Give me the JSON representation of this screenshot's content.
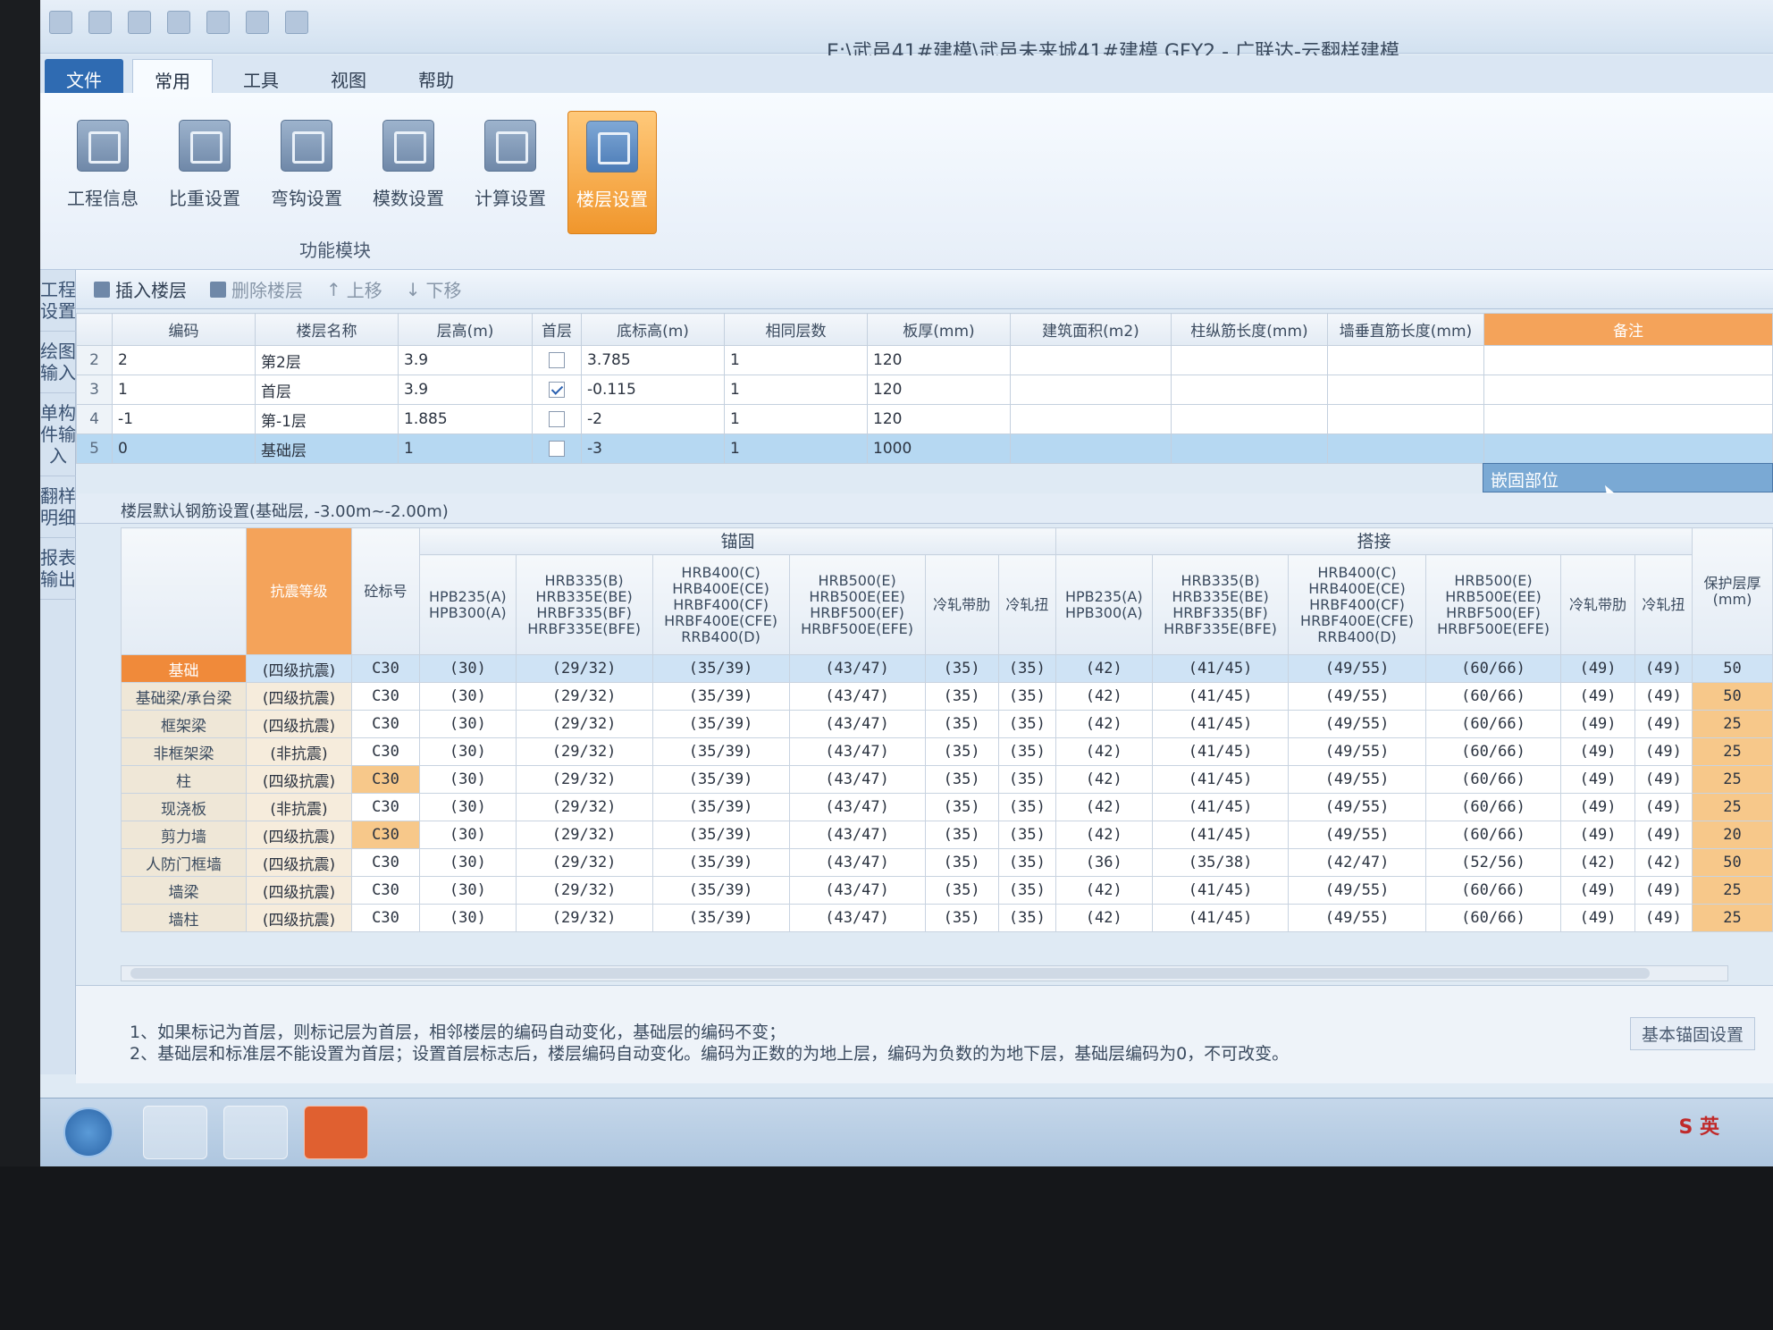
{
  "window": {
    "title": "E:\\武邑41#建模\\武邑未来城41#建模.GFY2 - 广联达-云翻样建模"
  },
  "menu_tabs": [
    "文件",
    "常用",
    "工具",
    "视图",
    "帮助"
  ],
  "ribbon": {
    "buttons": [
      "工程信息",
      "比重设置",
      "弯钩设置",
      "模数设置",
      "计算设置",
      "楼层设置"
    ],
    "group_label": "功能模块"
  },
  "sidebar": [
    "工程设置",
    "绘图输入",
    "单构件输入",
    "翻样明细",
    "报表输出"
  ],
  "toolbar": {
    "insert": "插入楼层",
    "delete": "删除楼层",
    "up": "上移",
    "down": "下移"
  },
  "floors": {
    "headers": [
      "",
      "编码",
      "楼层名称",
      "层高(m)",
      "首层",
      "底标高(m)",
      "相同层数",
      "板厚(mm)",
      "建筑面积(m2)",
      "柱纵筋长度(mm)",
      "墙垂直筋长度(mm)",
      "备注"
    ],
    "rows": [
      {
        "n": "2",
        "code": "2",
        "name": "第2层",
        "height": "3.9",
        "first": false,
        "bottom": "3.785",
        "same": "1",
        "slab": "120"
      },
      {
        "n": "3",
        "code": "1",
        "name": "首层",
        "height": "3.9",
        "first": true,
        "bottom": "-0.115",
        "same": "1",
        "slab": "120"
      },
      {
        "n": "4",
        "code": "-1",
        "name": "第-1层",
        "height": "1.885",
        "first": false,
        "bottom": "-2",
        "same": "1",
        "slab": "120"
      },
      {
        "n": "5",
        "code": "0",
        "name": "基础层",
        "height": "1",
        "first": false,
        "bottom": "-3",
        "same": "1",
        "slab": "1000"
      }
    ],
    "note_value": "嵌固部位"
  },
  "rebar_section": {
    "title": "楼层默认钢筋设置(基础层, -3.00m~-2.00m)",
    "group_anchor": "锚固",
    "group_lap": "搭接",
    "headers": [
      "抗震等级",
      "砼标号",
      "HPB235(A)\nHPB300(A)",
      "HRB335(B)\nHRB335E(BE)\nHRBF335(BF)\nHRBF335E(BFE)",
      "HRB400(C)\nHRB400E(CE)\nHRBF400(CF)\nHRBF400E(CFE)\nRRB400(D)",
      "HRB500(E)\nHRB500E(EE)\nHRBF500(EF)\nHRBF500E(EFE)",
      "冷轧带肋",
      "冷轧扭",
      "HPB235(A)\nHPB300(A)",
      "HRB335(B)\nHRB335E(BE)\nHRBF335(BF)\nHRBF335E(BFE)",
      "HRB400(C)\nHRB400E(CE)\nHRBF400(CF)\nHRBF400E(CFE)\nRRB400(D)",
      "HRB500(E)\nHRB500E(EE)\nHRBF500(EF)\nHRBF500E(EFE)",
      "冷轧带肋",
      "冷轧扭",
      "保护层厚\n(mm)"
    ],
    "rows": [
      {
        "name": "基础",
        "seis": "(四级抗震)",
        "c": "C30",
        "a": [
          "(30)",
          "(29/32)",
          "(35/39)",
          "(43/47)",
          "(35)",
          "(35)"
        ],
        "l": [
          "(42)",
          "(41/45)",
          "(49/55)",
          "(60/66)",
          "(49)",
          "(49)"
        ],
        "cover": "50"
      },
      {
        "name": "基础梁/承台梁",
        "seis": "(四级抗震)",
        "c": "C30",
        "a": [
          "(30)",
          "(29/32)",
          "(35/39)",
          "(43/47)",
          "(35)",
          "(35)"
        ],
        "l": [
          "(42)",
          "(41/45)",
          "(49/55)",
          "(60/66)",
          "(49)",
          "(49)"
        ],
        "cover": "50"
      },
      {
        "name": "框架梁",
        "seis": "(四级抗震)",
        "c": "C30",
        "a": [
          "(30)",
          "(29/32)",
          "(35/39)",
          "(43/47)",
          "(35)",
          "(35)"
        ],
        "l": [
          "(42)",
          "(41/45)",
          "(49/55)",
          "(60/66)",
          "(49)",
          "(49)"
        ],
        "cover": "25"
      },
      {
        "name": "非框架梁",
        "seis": "(非抗震)",
        "c": "C30",
        "a": [
          "(30)",
          "(29/32)",
          "(35/39)",
          "(43/47)",
          "(35)",
          "(35)"
        ],
        "l": [
          "(42)",
          "(41/45)",
          "(49/55)",
          "(60/66)",
          "(49)",
          "(49)"
        ],
        "cover": "25"
      },
      {
        "name": "柱",
        "seis": "(四级抗震)",
        "c": "C30",
        "a": [
          "(30)",
          "(29/32)",
          "(35/39)",
          "(43/47)",
          "(35)",
          "(35)"
        ],
        "l": [
          "(42)",
          "(41/45)",
          "(49/55)",
          "(60/66)",
          "(49)",
          "(49)"
        ],
        "cover": "25"
      },
      {
        "name": "现浇板",
        "seis": "(非抗震)",
        "c": "C30",
        "a": [
          "(30)",
          "(29/32)",
          "(35/39)",
          "(43/47)",
          "(35)",
          "(35)"
        ],
        "l": [
          "(42)",
          "(41/45)",
          "(49/55)",
          "(60/66)",
          "(49)",
          "(49)"
        ],
        "cover": "25"
      },
      {
        "name": "剪力墙",
        "seis": "(四级抗震)",
        "c": "C30",
        "a": [
          "(30)",
          "(29/32)",
          "(35/39)",
          "(43/47)",
          "(35)",
          "(35)"
        ],
        "l": [
          "(42)",
          "(41/45)",
          "(49/55)",
          "(60/66)",
          "(49)",
          "(49)"
        ],
        "cover": "20"
      },
      {
        "name": "人防门框墙",
        "seis": "(四级抗震)",
        "c": "C30",
        "a": [
          "(30)",
          "(29/32)",
          "(35/39)",
          "(43/47)",
          "(35)",
          "(35)"
        ],
        "l": [
          "(36)",
          "(35/38)",
          "(42/47)",
          "(52/56)",
          "(42)",
          "(42)"
        ],
        "cover": "50"
      },
      {
        "name": "墙梁",
        "seis": "(四级抗震)",
        "c": "C30",
        "a": [
          "(30)",
          "(29/32)",
          "(35/39)",
          "(43/47)",
          "(35)",
          "(35)"
        ],
        "l": [
          "(42)",
          "(41/45)",
          "(49/55)",
          "(60/66)",
          "(49)",
          "(49)"
        ],
        "cover": "25"
      },
      {
        "name": "墙柱",
        "seis": "(四级抗震)",
        "c": "C30",
        "a": [
          "(30)",
          "(29/32)",
          "(35/39)",
          "(43/47)",
          "(35)",
          "(35)"
        ],
        "l": [
          "(42)",
          "(41/45)",
          "(49/55)",
          "(60/66)",
          "(49)",
          "(49)"
        ],
        "cover": "25"
      }
    ]
  },
  "notes": [
    "1、如果标记为首层，则标记层为首层，相邻楼层的编码自动变化，基础层的编码不变；",
    "2、基础层和标准层不能设置为首层；设置首层标志后，楼层编码自动变化。编码为正数的为地上层，编码为负数的为地下层，基础层编码为0，不可改变。"
  ],
  "base_anchor_button": "基本锚固设置",
  "tray": {
    "ime": "英"
  }
}
